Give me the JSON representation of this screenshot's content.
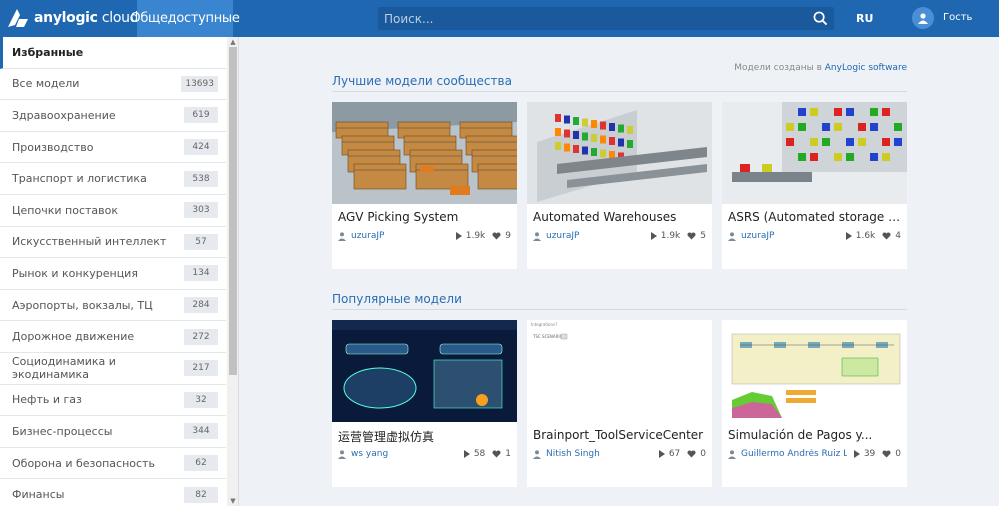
{
  "header": {
    "logo_brand": "anylogic",
    "logo_suffix": "cloud",
    "nav_tab": "Общедоступные",
    "search_placeholder": "Поиск...",
    "lang": "RU",
    "user": "Гость",
    "colors": {
      "bar": "#1f68b1",
      "active_tab": "#3a85cf"
    }
  },
  "sidebar": {
    "items": [
      {
        "label": "Избранные",
        "count": ""
      },
      {
        "label": "Все модели",
        "count": "13693"
      },
      {
        "label": "Здравоохранение",
        "count": "619"
      },
      {
        "label": "Производство",
        "count": "424"
      },
      {
        "label": "Транспорт и логистика",
        "count": "538"
      },
      {
        "label": "Цепочки поставок",
        "count": "303"
      },
      {
        "label": "Искусственный интеллект",
        "count": "57"
      },
      {
        "label": "Рынок и конкуренция",
        "count": "134"
      },
      {
        "label": "Аэропорты, вокзалы, ТЦ",
        "count": "284"
      },
      {
        "label": "Дорожное движение",
        "count": "272"
      },
      {
        "label": "Социодинамика и экодинамика",
        "count": "217"
      },
      {
        "label": "Нефть и газ",
        "count": "32"
      },
      {
        "label": "Бизнес-процессы",
        "count": "344"
      },
      {
        "label": "Оборона и безопасность",
        "count": "62"
      },
      {
        "label": "Финансы",
        "count": "82"
      }
    ]
  },
  "main": {
    "credit_prefix": "Модели созданы в",
    "credit_link": "AnyLogic software",
    "sections": [
      {
        "title": "Лучшие модели сообщества",
        "cards": [
          {
            "title": "AGV Picking System",
            "author": "uzuraJP",
            "runs": "1.9k",
            "likes": "9",
            "thumb": "warehouse-agv"
          },
          {
            "title": "Automated Warehouses",
            "author": "uzuraJP",
            "runs": "1.9k",
            "likes": "5",
            "thumb": "warehouse-racks"
          },
          {
            "title": "ASRS (Automated storage and...",
            "author": "uzuraJP",
            "runs": "1.6k",
            "likes": "4",
            "thumb": "asrs-rack"
          }
        ]
      },
      {
        "title": "Популярные модели",
        "cards": [
          {
            "title": "运营管理虚拟仿真",
            "author": "ws yang",
            "runs": "58",
            "likes": "1",
            "thumb": "factory-dark"
          },
          {
            "title": "Brainport_ToolServiceCenter",
            "author": "Nitish Singh",
            "runs": "67",
            "likes": "0",
            "thumb": "blank-canvas",
            "thumb_text_1": "Integrations?",
            "thumb_text_2": "TSC SCENARIO"
          },
          {
            "title": "Simulación de Pagos y...",
            "author": "Guillermo Andrés Ruiz Ló...",
            "runs": "39",
            "likes": "0",
            "thumb": "process-diagram"
          }
        ]
      }
    ]
  }
}
